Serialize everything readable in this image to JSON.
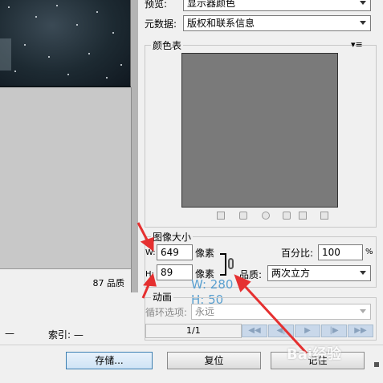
{
  "preview": {
    "quality_text": "87 品质",
    "bottom_dash": "—",
    "index_label": "索引: —"
  },
  "settings": {
    "preview_label": "预览:",
    "preview_value": "显示器颜色",
    "metadata_label": "元数据:",
    "metadata_value": "版权和联系信息",
    "color_table_title": "颜色表",
    "color_table_menu_icon": "▾≡"
  },
  "image_size": {
    "title": "图像大小",
    "w_label": "W:",
    "w_value": "649",
    "w_unit": "像素",
    "h_label": "H:",
    "h_value": "89",
    "h_unit": "像素",
    "percent_label": "百分比:",
    "percent_value": "100",
    "percent_unit": "%",
    "quality_label": "品质:",
    "quality_value": "两次立方"
  },
  "annotation": {
    "w_note": "W: 280",
    "h_note": "H:  50",
    "arrow_color": "#e53030"
  },
  "animation": {
    "title": "动画",
    "loop_label": "循环选项:",
    "loop_value": "永远",
    "frame_counter": "1/1",
    "nav_first": "◀◀",
    "nav_prev": "◀|",
    "nav_play": "▶",
    "nav_next": "|▶",
    "nav_last": "▶▶"
  },
  "buttons": {
    "save": "存储...",
    "reset": "复位",
    "remember": "记住"
  },
  "watermark": "Bai经验"
}
